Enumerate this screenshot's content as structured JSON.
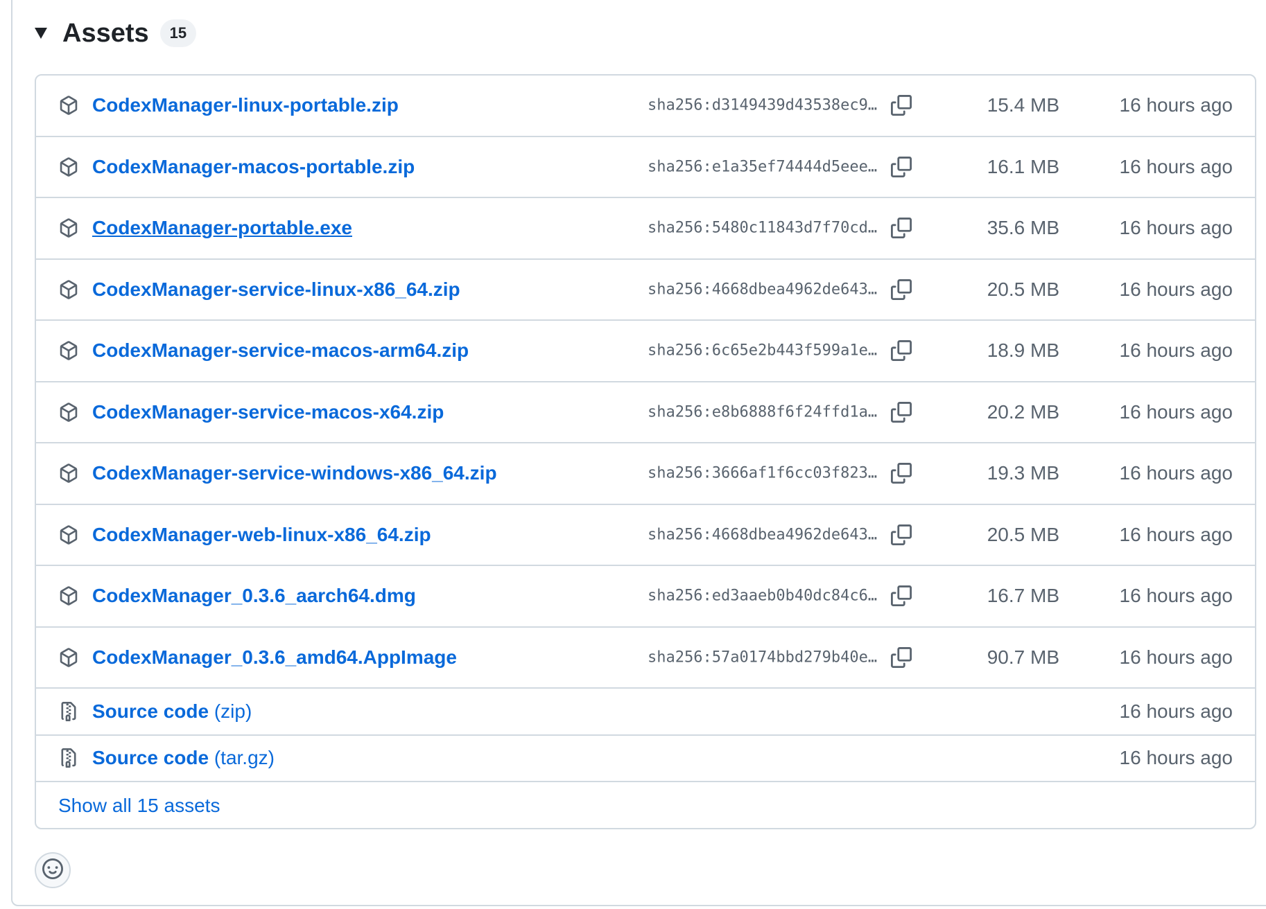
{
  "assets": {
    "title": "Assets",
    "count": "15",
    "items": [
      {
        "name": "CodexManager-linux-portable.zip",
        "sha": "sha256:d3149439d43538ec9…",
        "size": "15.4 MB",
        "time": "16 hours ago"
      },
      {
        "name": "CodexManager-macos-portable.zip",
        "sha": "sha256:e1a35ef74444d5eee…",
        "size": "16.1 MB",
        "time": "16 hours ago"
      },
      {
        "name": "CodexManager-portable.exe",
        "sha": "sha256:5480c11843d7f70cd…",
        "size": "35.6 MB",
        "time": "16 hours ago"
      },
      {
        "name": "CodexManager-service-linux-x86_64.zip",
        "sha": "sha256:4668dbea4962de643…",
        "size": "20.5 MB",
        "time": "16 hours ago"
      },
      {
        "name": "CodexManager-service-macos-arm64.zip",
        "sha": "sha256:6c65e2b443f599a1e…",
        "size": "18.9 MB",
        "time": "16 hours ago"
      },
      {
        "name": "CodexManager-service-macos-x64.zip",
        "sha": "sha256:e8b6888f6f24ffd1a…",
        "size": "20.2 MB",
        "time": "16 hours ago"
      },
      {
        "name": "CodexManager-service-windows-x86_64.zip",
        "sha": "sha256:3666af1f6cc03f823…",
        "size": "19.3 MB",
        "time": "16 hours ago"
      },
      {
        "name": "CodexManager-web-linux-x86_64.zip",
        "sha": "sha256:4668dbea4962de643…",
        "size": "20.5 MB",
        "time": "16 hours ago"
      },
      {
        "name": "CodexManager_0.3.6_aarch64.dmg",
        "sha": "sha256:ed3aaeb0b40dc84c6…",
        "size": "16.7 MB",
        "time": "16 hours ago"
      },
      {
        "name": "CodexManager_0.3.6_amd64.AppImage",
        "sha": "sha256:57a0174bbd279b40e…",
        "size": "90.7 MB",
        "time": "16 hours ago"
      }
    ],
    "sources": [
      {
        "label": "Source code",
        "format": "(zip)",
        "time": "16 hours ago"
      },
      {
        "label": "Source code",
        "format": "(tar.gz)",
        "time": "16 hours ago"
      }
    ],
    "show_all": "Show all 15 assets"
  },
  "icons": {
    "caret": "triangle-down-icon",
    "package": "package-icon",
    "copy": "copy-icon",
    "file_zip": "file-zip-icon",
    "reaction": "smiley-icon"
  },
  "colors": {
    "link": "#0969da",
    "muted": "#59636e",
    "border": "#d1d9e0"
  }
}
